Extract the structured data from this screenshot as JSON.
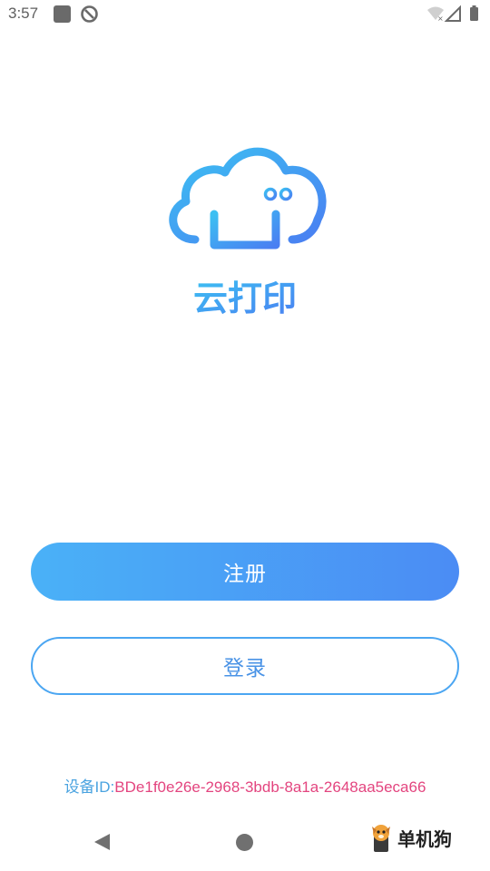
{
  "status_bar": {
    "time": "3:57"
  },
  "logo": {
    "app_name": "云打印",
    "icon": "cloud-printer-icon"
  },
  "buttons": {
    "register_label": "注册",
    "login_label": "登录"
  },
  "device": {
    "label": "设备ID:",
    "value": "BDe1f0e26e-2968-3bdb-8a1a-2648aa5eca66"
  },
  "watermark": {
    "text": "单机狗"
  },
  "colors": {
    "accent_start": "#4ab1f7",
    "accent_end": "#4b8cf4",
    "device_label": "#4aa3e0",
    "device_value": "#e3457f"
  }
}
